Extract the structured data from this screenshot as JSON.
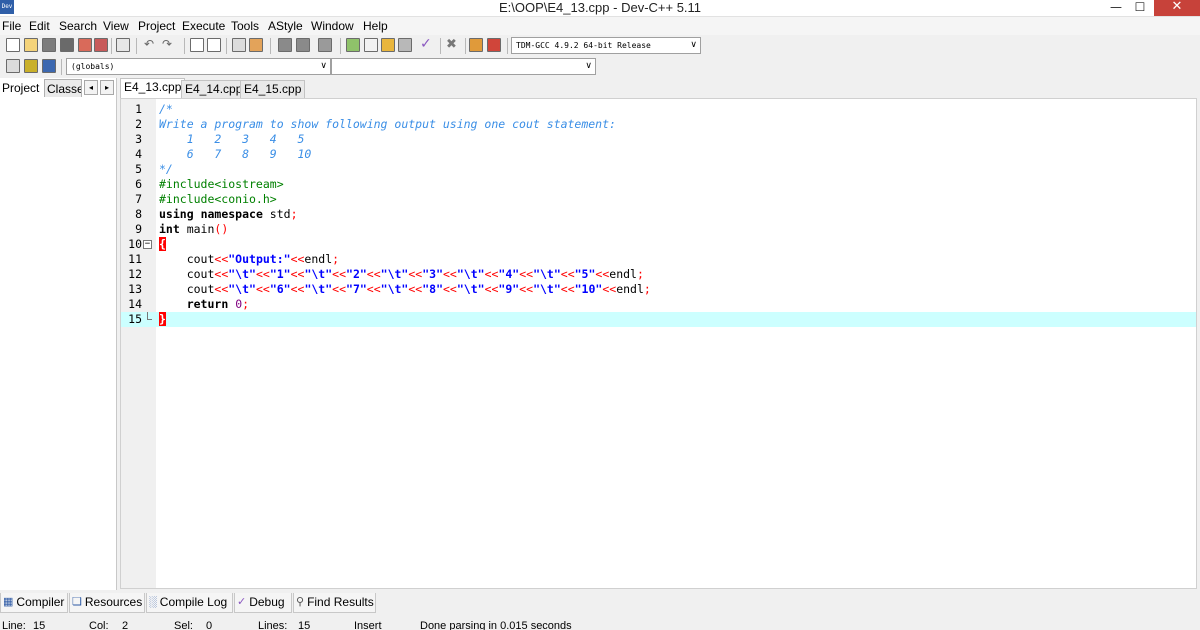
{
  "window": {
    "title": "E:\\OOP\\E4_13.cpp - Dev-C++ 5.11",
    "app_icon_text": "Dev",
    "minimize": "—",
    "maximize": "☐",
    "close": "✕"
  },
  "menu": [
    "File",
    "Edit",
    "Search",
    "View",
    "Project",
    "Execute",
    "Tools",
    "AStyle",
    "Window",
    "Help"
  ],
  "toolbar": {
    "compiler_select": "TDM-GCC 4.9.2 64-bit Release",
    "scope_select": "(globals)",
    "symbol_select": ""
  },
  "left_panel": {
    "tabs": [
      "Project",
      "Classes"
    ],
    "nav_left": "◂",
    "nav_right": "▸"
  },
  "editor_tabs": [
    "E4_13.cpp",
    "E4_14.cpp",
    "E4_15.cpp"
  ],
  "code_lines": [
    "/*",
    "Write a program to show following output using one cout statement:",
    "    1   2   3   4   5",
    "    6   7   8   9   10",
    "*/",
    "#include<iostream>",
    "#include<conio.h>",
    "using namespace std;",
    "int main()",
    "{",
    "    cout<<\"Output:\"<<endl;",
    "    cout<<\"\\t\"<<\"1\"<<\"\\t\"<<\"2\"<<\"\\t\"<<\"3\"<<\"\\t\"<<\"4\"<<\"\\t\"<<\"5\"<<endl;",
    "    cout<<\"\\t\"<<\"6\"<<\"\\t\"<<\"7\"<<\"\\t\"<<\"8\"<<\"\\t\"<<\"9\"<<\"\\t\"<<\"10\"<<endl;",
    "    return 0;",
    "}"
  ],
  "bottom_tabs": [
    "Compiler",
    "Resources",
    "Compile Log",
    "Debug",
    "Find Results"
  ],
  "status": {
    "line_label": "Line:",
    "line_value": "15",
    "col_label": "Col:",
    "col_value": "2",
    "sel_label": "Sel:",
    "sel_value": "0",
    "lines_label": "Lines:",
    "lines_value": "15",
    "mode": "Insert",
    "message": "Done parsing in 0.015 seconds"
  },
  "colors": {
    "comment": "#3a8ee6",
    "preprocessor": "#008000",
    "string": "#0000ff",
    "operator": "#ff0000",
    "number": "#800080",
    "current_line": "#ccffff",
    "close_button": "#c7423a"
  }
}
